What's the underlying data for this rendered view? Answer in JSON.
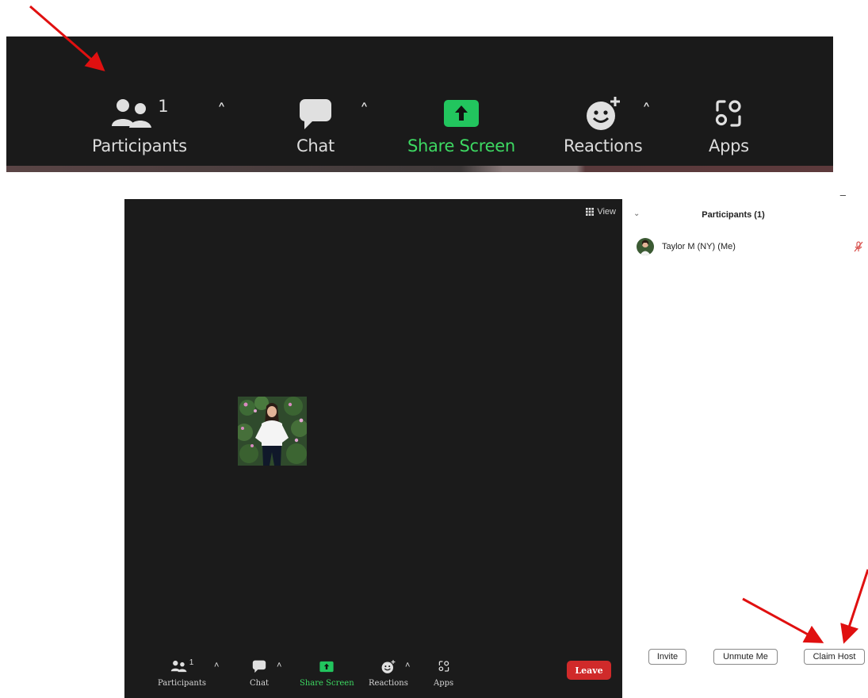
{
  "top_toolbar": {
    "participants_label": "Participants",
    "participants_count": "1",
    "chat_label": "Chat",
    "share_screen_label": "Share Screen",
    "reactions_label": "Reactions",
    "apps_label": "Apps"
  },
  "meeting": {
    "view_label": "View",
    "toolbar": {
      "participants_label": "Participants",
      "participants_count": "1",
      "chat_label": "Chat",
      "share_screen_label": "Share Screen",
      "reactions_label": "Reactions",
      "apps_label": "Apps",
      "leave_label": "Leave"
    }
  },
  "panel": {
    "minimize_glyph": "–",
    "title": "Participants (1)",
    "participant_name": "Taylor M (NY) (Me)",
    "invite_label": "Invite",
    "unmute_label": "Unmute Me",
    "claim_host_label": "Claim Host"
  },
  "colors": {
    "accent_green": "#22c55e",
    "leave_red": "#d02a2a",
    "arrow_red": "#e01010",
    "muted_red": "#d9534f"
  },
  "icons": [
    "participants-icon",
    "chat-icon",
    "share-screen-icon",
    "reactions-icon",
    "apps-icon",
    "grid-icon",
    "muted-mic-icon",
    "caret-up-icon",
    "chevron-down-icon"
  ]
}
